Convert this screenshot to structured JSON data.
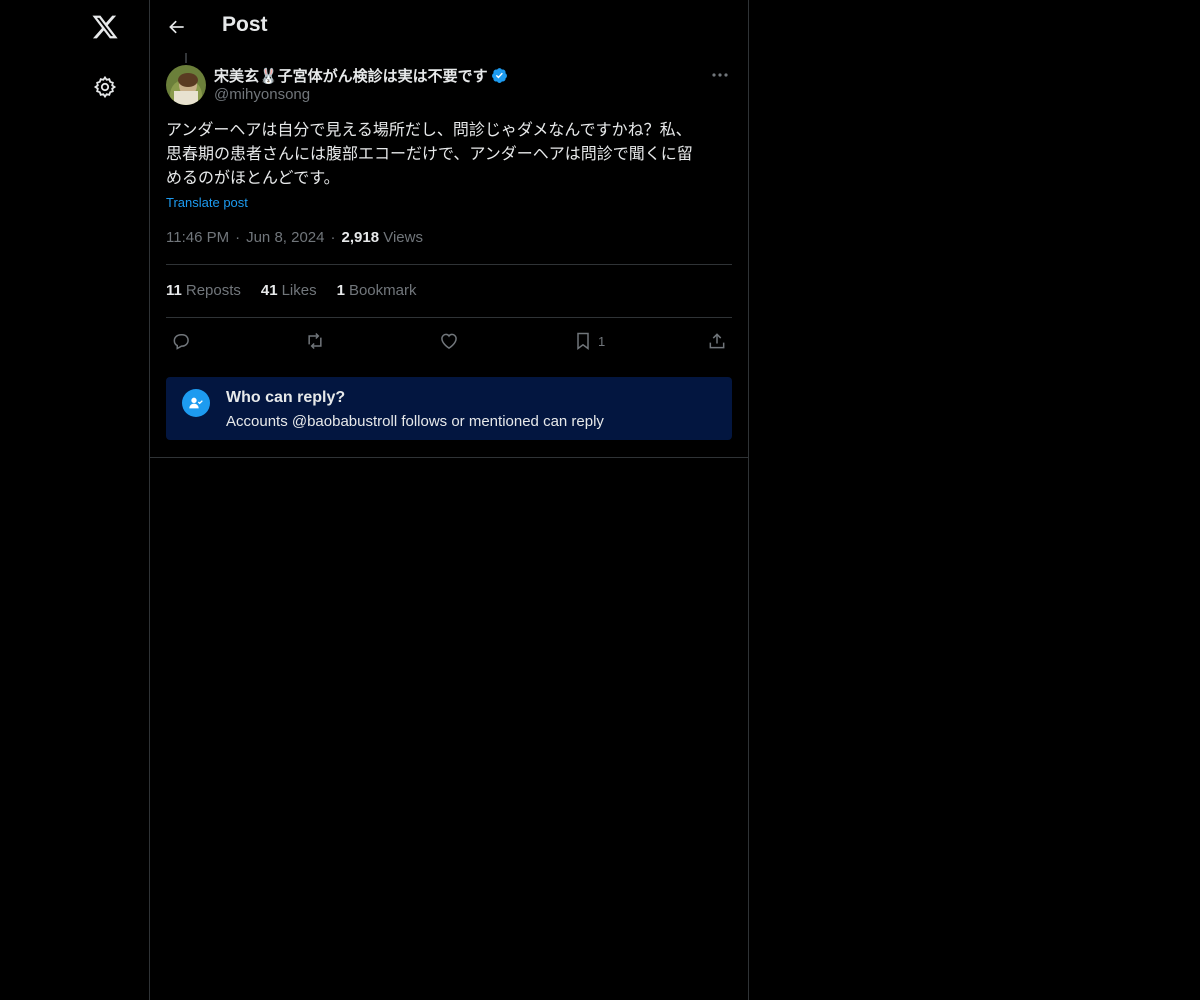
{
  "header": {
    "title": "Post",
    "back_icon": "arrow-left-icon"
  },
  "rail": {
    "logo_icon": "x-logo-icon",
    "settings_icon": "gear-icon"
  },
  "post": {
    "display_name": "宋美玄🐰子宮体がん検診は実は不要です",
    "handle": "@mihyonsong",
    "verified": true,
    "text": "アンダーヘアは自分で見える場所だし、問診じゃダメなんですかね？私、\n思春期の患者さんには腹部エコーだけで、アンダーヘアは問診で聞くに留\nめるのがほとんどです。",
    "translate_label": "Translate post",
    "time": "11:46 PM",
    "date": "Jun 8, 2024",
    "views_count": "2,918",
    "views_label": "Views"
  },
  "stats": {
    "reposts_count": "11",
    "reposts_label": "Reposts",
    "likes_count": "41",
    "likes_label": "Likes",
    "bookmarks_count": "1",
    "bookmarks_label": "Bookmark"
  },
  "actions": {
    "bookmark_count": "1"
  },
  "reply_restriction": {
    "title": "Who can reply?",
    "subtitle": "Accounts @baobabustroll follows or mentioned can reply"
  },
  "colors": {
    "background": "#000000",
    "accent": "#1d9bf0",
    "muted": "#71767b",
    "reply_box": "#031640"
  }
}
